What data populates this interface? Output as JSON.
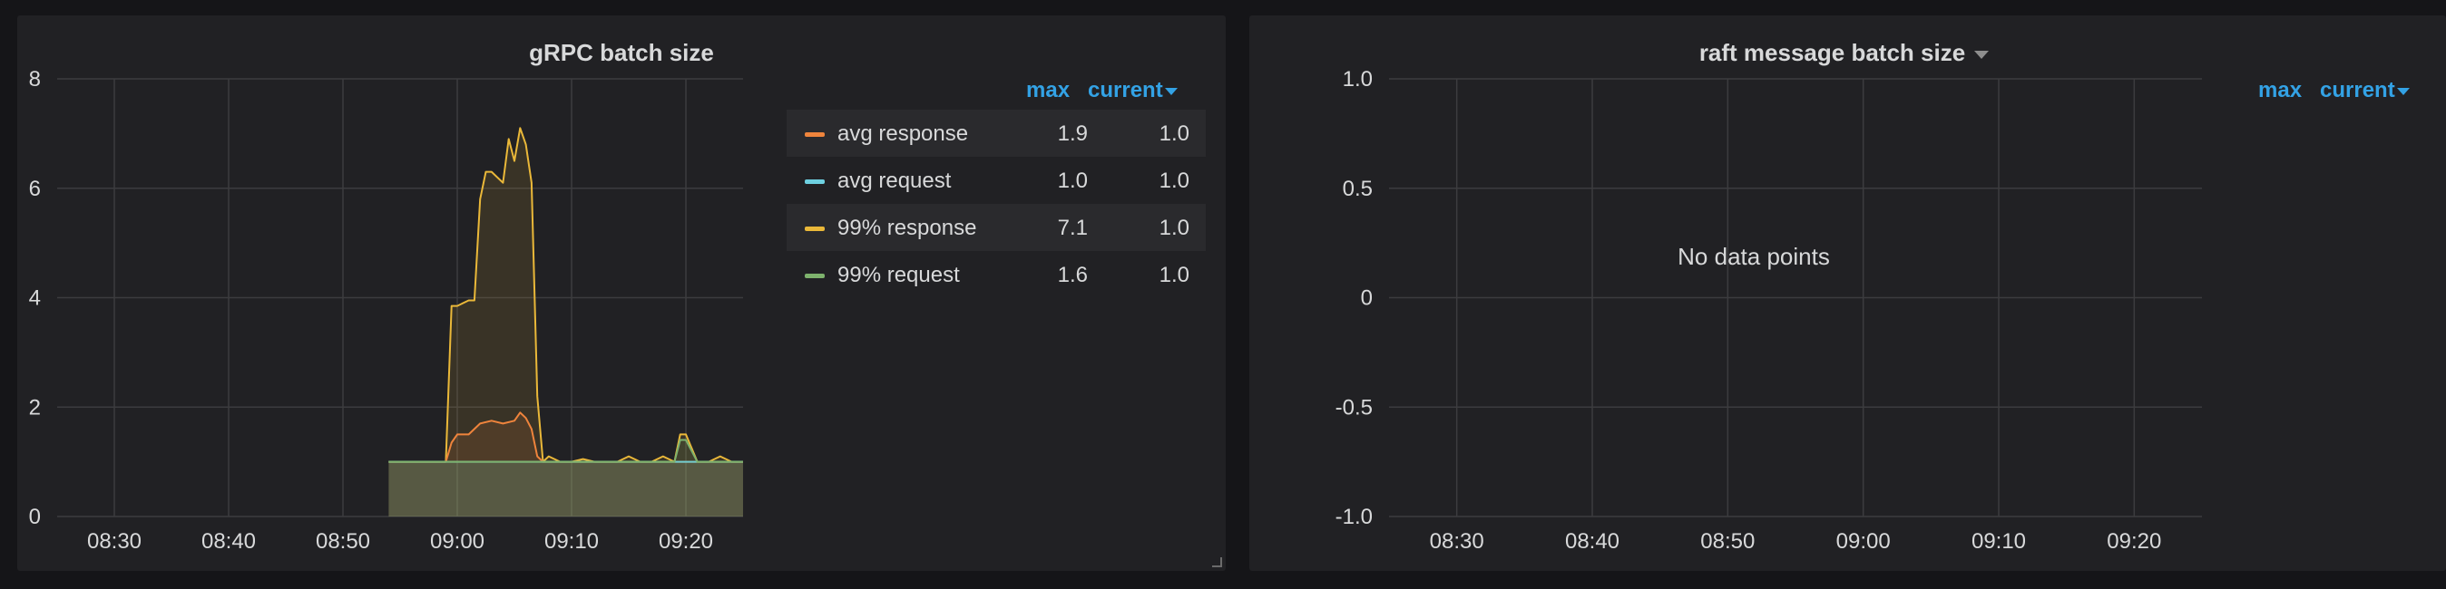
{
  "panels": [
    {
      "title": "gRPC batch size",
      "legend": {
        "headers": {
          "max": "max",
          "current": "current"
        },
        "items": [
          {
            "name": "avg response",
            "max": "1.9",
            "current": "1.0",
            "color": "#ef843c"
          },
          {
            "name": "avg request",
            "max": "1.0",
            "current": "1.0",
            "color": "#6ed0e0"
          },
          {
            "name": "99% response",
            "max": "7.1",
            "current": "1.0",
            "color": "#eab839"
          },
          {
            "name": "99% request",
            "max": "1.6",
            "current": "1.0",
            "color": "#7eb26d"
          }
        ]
      }
    },
    {
      "title": "raft message batch size",
      "no_data_text": "No data points",
      "legend": {
        "headers": {
          "max": "max",
          "current": "current"
        },
        "items": []
      }
    }
  ],
  "chart_data": [
    {
      "type": "line",
      "title": "gRPC batch size",
      "xlabel": "",
      "ylabel": "",
      "x_ticks": [
        "08:30",
        "08:40",
        "08:50",
        "09:00",
        "09:10",
        "09:20"
      ],
      "y_ticks": [
        "0",
        "2",
        "4",
        "6",
        "8"
      ],
      "xlim": [
        "08:25",
        "09:25"
      ],
      "ylim": [
        0,
        8
      ],
      "grid": true,
      "legend_position": "right",
      "series": [
        {
          "name": "99% response",
          "color": "#eab839",
          "x": [
            "08:54",
            "08:59",
            "08:59.5",
            "09:00",
            "09:01",
            "09:01.5",
            "09:02",
            "09:02.5",
            "09:03",
            "09:04",
            "09:04.5",
            "09:05",
            "09:05.5",
            "09:06",
            "09:06.5",
            "09:07",
            "09:07.5",
            "09:08",
            "09:09",
            "09:10",
            "09:11",
            "09:12",
            "09:13",
            "09:14",
            "09:15",
            "09:16",
            "09:17",
            "09:18",
            "09:19",
            "09:19.5",
            "09:20",
            "09:21",
            "09:22",
            "09:23",
            "09:24",
            "09:25"
          ],
          "y": [
            1.0,
            1.0,
            3.85,
            3.85,
            3.95,
            3.95,
            5.8,
            6.3,
            6.3,
            6.1,
            6.9,
            6.5,
            7.1,
            6.8,
            6.1,
            2.2,
            1.0,
            1.1,
            1.0,
            1.0,
            1.05,
            1.0,
            1.0,
            1.0,
            1.1,
            1.0,
            1.0,
            1.1,
            1.0,
            1.5,
            1.5,
            1.0,
            1.0,
            1.1,
            1.0,
            1.0
          ]
        },
        {
          "name": "avg response",
          "color": "#ef843c",
          "x": [
            "08:54",
            "08:59",
            "08:59.5",
            "09:00",
            "09:01",
            "09:02",
            "09:03",
            "09:04",
            "09:05",
            "09:05.5",
            "09:06",
            "09:06.5",
            "09:07",
            "09:07.5",
            "09:08",
            "09:25"
          ],
          "y": [
            1.0,
            1.0,
            1.35,
            1.5,
            1.5,
            1.7,
            1.75,
            1.7,
            1.75,
            1.9,
            1.8,
            1.6,
            1.1,
            1.0,
            1.0,
            1.0
          ]
        },
        {
          "name": "avg request",
          "color": "#6ed0e0",
          "x": [
            "08:54",
            "09:07",
            "09:25"
          ],
          "y": [
            1.0,
            1.0,
            1.0
          ]
        },
        {
          "name": "99% request",
          "color": "#7eb26d",
          "x": [
            "08:54",
            "09:19",
            "09:19.5",
            "09:20",
            "09:21",
            "09:25"
          ],
          "y": [
            1.0,
            1.0,
            1.4,
            1.4,
            1.0,
            1.0
          ]
        }
      ]
    },
    {
      "type": "line",
      "title": "raft message batch size",
      "xlabel": "",
      "ylabel": "",
      "x_ticks": [
        "08:30",
        "08:40",
        "08:50",
        "09:00",
        "09:10",
        "09:20"
      ],
      "y_ticks": [
        "1.0",
        "0.5",
        "0",
        "-0.5",
        "-1.0"
      ],
      "xlim": [
        "08:25",
        "09:25"
      ],
      "ylim": [
        -1.0,
        1.0
      ],
      "grid": true,
      "legend_position": "right",
      "series": []
    }
  ]
}
